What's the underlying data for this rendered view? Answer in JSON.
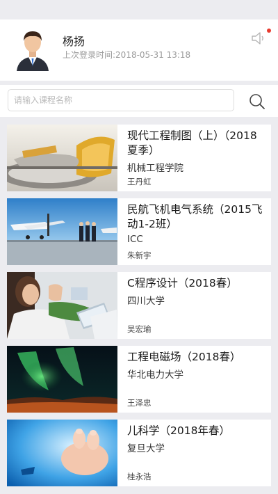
{
  "user": {
    "name": "杨扬",
    "last_login": "上次登录时间:2018-05-31 13:18",
    "avatar_icon": "avatar-icon",
    "notification_icon": "speaker-icon",
    "badge_color": "#e83a2e"
  },
  "search": {
    "placeholder": "请输入课程名称",
    "value": "",
    "icon": "search-icon"
  },
  "courses": [
    {
      "title": "现代工程制图（上）（2018夏季）",
      "school": "机械工程学院",
      "teacher": "王丹虹",
      "image": "engineering-parts"
    },
    {
      "title": "民航飞机电气系统（2015飞动1-2班）",
      "school": "ICC",
      "teacher": "朱新宇",
      "image": "airplane"
    },
    {
      "title": "C程序设计（2018春）",
      "school": "四川大学",
      "teacher": "吴宏瑜",
      "image": "students-laptops"
    },
    {
      "title": "工程电磁场（2018春）",
      "school": "华北电力大学",
      "teacher": "王泽忠",
      "image": "aurora"
    },
    {
      "title": "儿科学（2018年春）",
      "school": "复旦大学",
      "teacher": "桂永浩",
      "image": "baby-feet"
    }
  ]
}
